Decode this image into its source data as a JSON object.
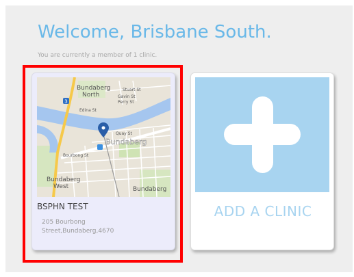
{
  "header": {
    "welcome_text": "Welcome, Brisbane South.",
    "membership_note": "You are currently a member of 1 clinic."
  },
  "clinics": [
    {
      "name": "BSPHN TEST",
      "address": "205 Bourbong Street,Bundaberg,4670",
      "map_labels": {
        "area_north": "Bundaberg",
        "area_north_2": "North",
        "town": "Bundaberg",
        "area_west": "Bundaberg",
        "area_west_2": "West",
        "area_south": "Bundaberg",
        "street_1": "Stuart St",
        "street_2": "Gavin St",
        "street_3": "Perry St",
        "street_4": "Edina St",
        "street_5": "Quay St",
        "street_6": "Bourbong St",
        "route_badge": "3"
      }
    }
  ],
  "add_clinic": {
    "label": "ADD A CLINIC"
  },
  "colors": {
    "accent_blue": "#69b8e8",
    "tile_blue": "#a8d4f0",
    "highlight_red": "#ff0000"
  }
}
